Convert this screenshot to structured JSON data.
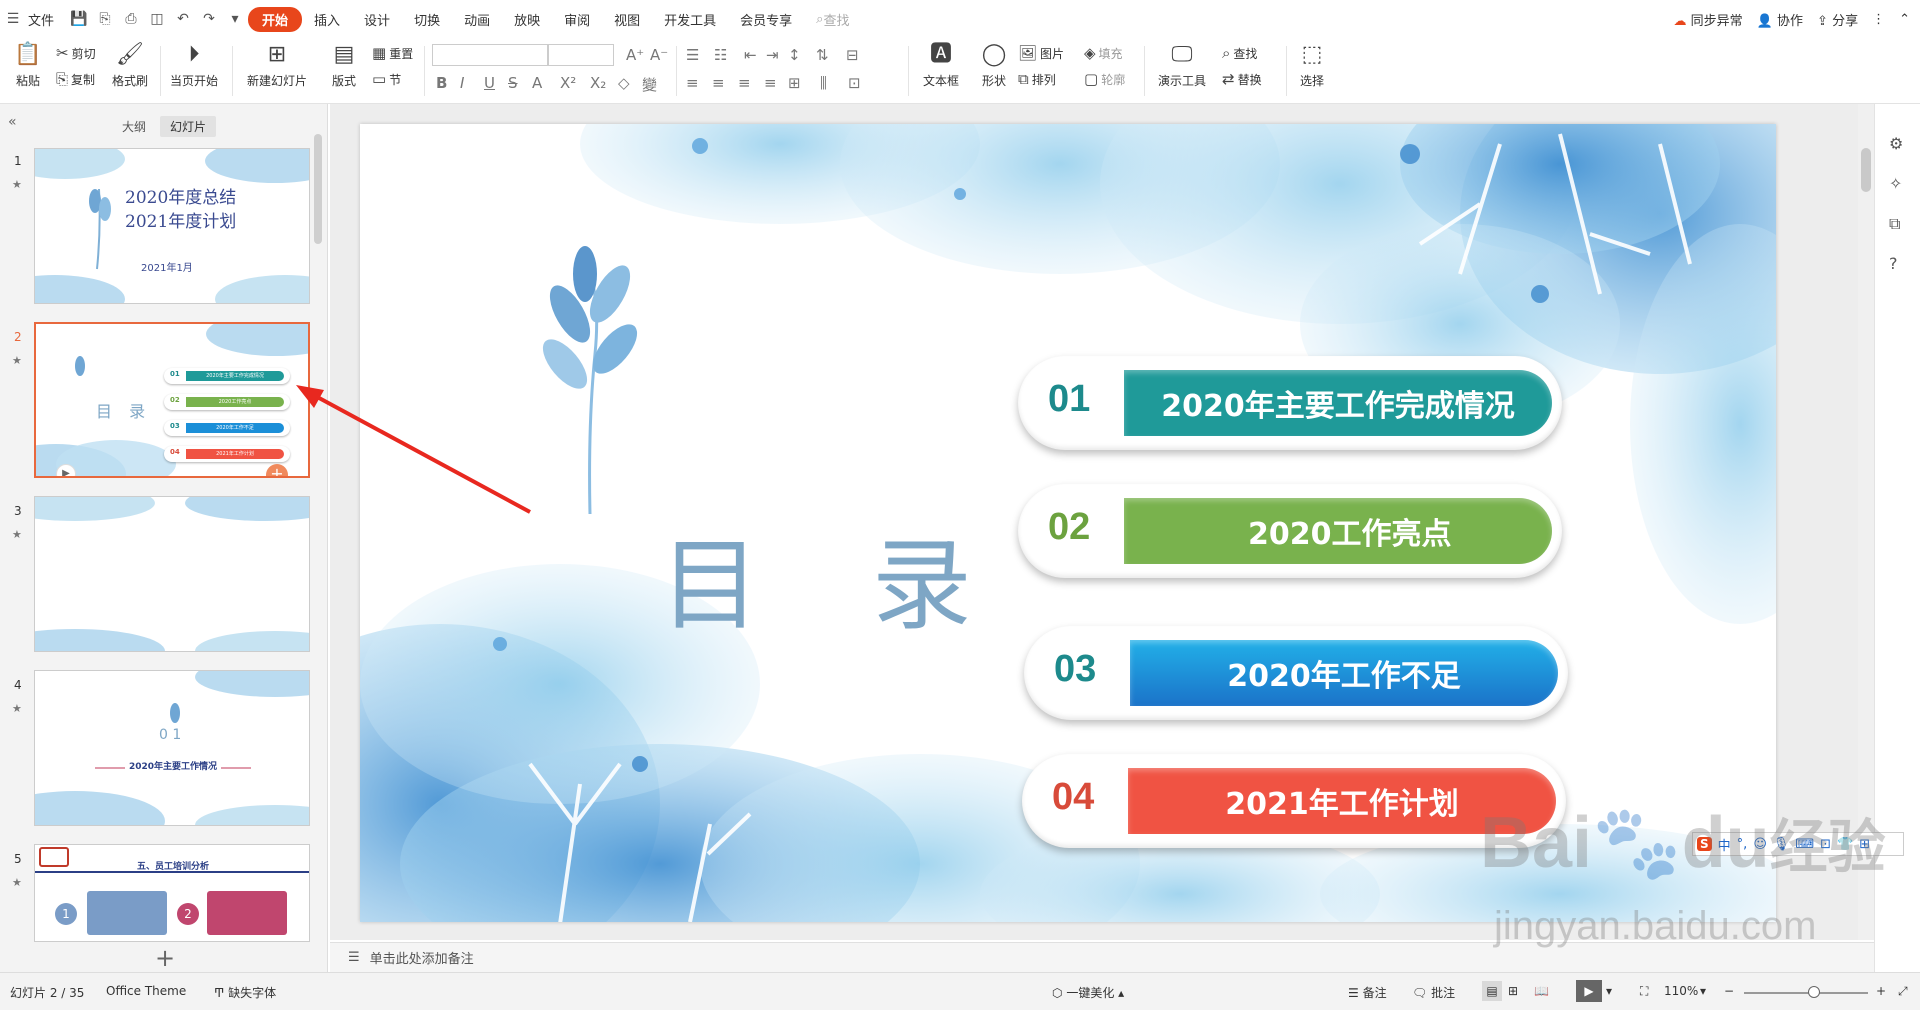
{
  "menubar": {
    "file": "文件",
    "tabs": [
      "开始",
      "插入",
      "设计",
      "切换",
      "动画",
      "放映",
      "审阅",
      "视图",
      "开发工具",
      "会员专享"
    ],
    "active_tab": "开始",
    "search_placeholder": "查找",
    "sync": "同步异常",
    "collab": "协作",
    "share": "分享"
  },
  "ribbon": {
    "paste": "粘贴",
    "cut": "剪切",
    "copy": "复制",
    "format_painter": "格式刷",
    "from_current": "当页开始",
    "new_slide": "新建幻灯片",
    "layout": "版式",
    "reset": "重置",
    "section": "节",
    "textbox": "文本框",
    "shape": "形状",
    "picture": "图片",
    "fill": "填充",
    "arrange": "排列",
    "outline": "轮廓",
    "present_tools": "演示工具",
    "find": "查找",
    "replace": "替换",
    "select": "选择"
  },
  "panel": {
    "tab_outline": "大纲",
    "tab_slides": "幻灯片",
    "thumbs": [
      {
        "num": "1",
        "title1": "2020年度总结",
        "title2": "2021年度计划",
        "date": "2021年1月"
      },
      {
        "num": "2",
        "title": "目 录",
        "items": [
          "01",
          "02",
          "03",
          "04"
        ],
        "labels": [
          "2020年主要工作完成情况",
          "2020工作亮点",
          "2020年工作不足",
          "2021年工作计划"
        ]
      },
      {
        "num": "3"
      },
      {
        "num": "4",
        "title": "0 1",
        "sub": "2020年主要工作情况"
      },
      {
        "num": "5",
        "title": "五、员工培训分析",
        "b1": "1",
        "b2": "2"
      }
    ]
  },
  "slide": {
    "title": "目 录",
    "items": [
      {
        "num": "01",
        "text": "2020年主要工作完成情况",
        "num_color": "#1d8a8c",
        "bar_color": "#1f9a99"
      },
      {
        "num": "02",
        "text": "2020工作亮点",
        "num_color": "#6ca23f",
        "bar_color": "#79b24d"
      },
      {
        "num": "03",
        "text": "2020年工作不足",
        "num_color": "#1d8a8c",
        "bar_color": "#1b8fd8"
      },
      {
        "num": "04",
        "text": "2021年工作计划",
        "num_color": "#d84b3a",
        "bar_color": "#f05343"
      }
    ]
  },
  "notes": {
    "placeholder": "单击此处添加备注"
  },
  "status": {
    "slide_count": "幻灯片 2 / 35",
    "theme": "Office Theme",
    "missing_font": "缺失字体",
    "beautify": "一键美化",
    "notes": "备注",
    "comments": "批注",
    "zoom": "110%"
  },
  "ime": {
    "logo": "S",
    "lang": "中"
  },
  "watermark": {
    "line1": "Bai",
    "line1b": "du",
    "line1c": "经验",
    "line2": "jingyan.baidu.com"
  }
}
